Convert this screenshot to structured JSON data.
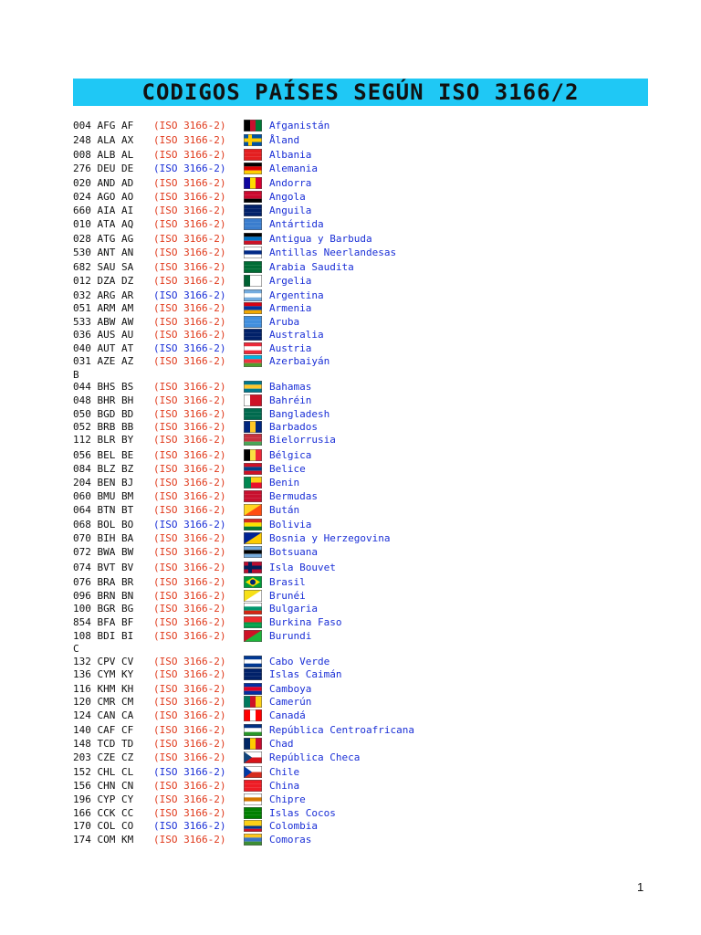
{
  "title": "CODIGOS PAÍSES SEGÚN ISO 3166/2",
  "page_number": "1",
  "colors": {
    "red": "#e03a1c",
    "blue": "#1a2fd6"
  },
  "entries": [
    {
      "codes": "004 AFG AF",
      "iso": "(ISO 3166-2)",
      "iso_color": "red",
      "name": "Afganistán",
      "flag": [
        "#000000",
        "#c8102e",
        "#007a36"
      ],
      "flag_dir": "v"
    },
    {
      "codes": "248 ALA AX",
      "iso": "(ISO 3166-2)",
      "iso_color": "red",
      "name": "Åland",
      "flag": [
        "#0053a5",
        "#ffce00",
        "#0053a5"
      ],
      "flag_dir": "nordic"
    },
    {
      "codes": "008 ALB AL",
      "iso": "(ISO 3166-2)",
      "iso_color": "red",
      "name": "Albania",
      "flag": [
        "#e41e20",
        "#e41e20",
        "#e41e20"
      ],
      "flag_dir": "h"
    },
    {
      "codes": "276 DEU DE",
      "iso": "(ISO 3166-2)",
      "iso_color": "blue",
      "name": "Alemania",
      "flag": [
        "#000000",
        "#dd0000",
        "#ffce00"
      ],
      "flag_dir": "h"
    },
    {
      "codes": "020 AND AD",
      "iso": "(ISO 3166-2)",
      "iso_color": "red",
      "name": "Andorra",
      "flag": [
        "#10069f",
        "#fedd00",
        "#d50032"
      ],
      "flag_dir": "v"
    },
    {
      "codes": "024 AGO AO",
      "iso": "(ISO 3166-2)",
      "iso_color": "red",
      "name": "Angola",
      "flag": [
        "#cc092f",
        "#cc092f",
        "#000000"
      ],
      "flag_dir": "h"
    },
    {
      "codes": "660 AIA AI",
      "iso": "(ISO 3166-2)",
      "iso_color": "red",
      "name": "Anguila",
      "flag": [
        "#012169",
        "#012169",
        "#012169"
      ],
      "flag_dir": "h"
    },
    {
      "codes": "010 ATA AQ",
      "iso": "(ISO 3166-2)",
      "iso_color": "red",
      "name": "Antártida",
      "flag": [
        "#3a7dce",
        "#3a7dce",
        "#3a7dce"
      ],
      "flag_dir": "h"
    },
    {
      "codes": "028 ATG AG",
      "iso": "(ISO 3166-2)",
      "iso_color": "red",
      "name": "Antigua y Barbuda",
      "flag": [
        "#000000",
        "#0072c6",
        "#ce1126"
      ],
      "flag_dir": "h"
    },
    {
      "codes": "530 ANT AN",
      "iso": "(ISO 3166-2)",
      "iso_color": "red",
      "name": "Antillas Neerlandesas",
      "flag": [
        "#ffffff",
        "#012a87",
        "#ffffff"
      ],
      "flag_dir": "h"
    },
    {
      "codes": "682 SAU SA",
      "iso": "(ISO 3166-2)",
      "iso_color": "red",
      "name": "Arabia Saudita",
      "flag": [
        "#006c35",
        "#006c35",
        "#006c35"
      ],
      "flag_dir": "h"
    },
    {
      "codes": "012 DZA DZ",
      "iso": "(ISO 3166-2)",
      "iso_color": "red",
      "name": "Argelia",
      "flag": [
        "#006233",
        "#ffffff",
        "#ffffff"
      ],
      "flag_dir": "v"
    },
    {
      "codes": "032 ARG AR",
      "iso": "(ISO 3166-2)",
      "iso_color": "blue",
      "name": "Argentina",
      "flag": [
        "#74acdf",
        "#ffffff",
        "#74acdf"
      ],
      "flag_dir": "h"
    },
    {
      "codes": "051 ARM AM",
      "iso": "(ISO 3166-2)",
      "iso_color": "red",
      "name": "Armenia",
      "flag": [
        "#d90012",
        "#0033a0",
        "#f2a800"
      ],
      "flag_dir": "h"
    },
    {
      "codes": "533 ABW AW",
      "iso": "(ISO 3166-2)",
      "iso_color": "red",
      "name": "Aruba",
      "flag": [
        "#418fde",
        "#418fde",
        "#418fde"
      ],
      "flag_dir": "h"
    },
    {
      "codes": "036 AUS AU",
      "iso": "(ISO 3166-2)",
      "iso_color": "red",
      "name": "Australia",
      "flag": [
        "#012169",
        "#012169",
        "#012169"
      ],
      "flag_dir": "h"
    },
    {
      "codes": "040 AUT AT",
      "iso": "(ISO 3166-2)",
      "iso_color": "blue",
      "name": "Austria",
      "flag": [
        "#ed2939",
        "#ffffff",
        "#ed2939"
      ],
      "flag_dir": "h"
    },
    {
      "codes": "031 AZE AZ",
      "iso": "(ISO 3166-2)",
      "iso_color": "red",
      "name": "Azerbaiyán",
      "flag": [
        "#00b5e2",
        "#ef3340",
        "#509e2f"
      ],
      "flag_dir": "h"
    },
    {
      "letter": "B"
    },
    {
      "codes": "044 BHS BS",
      "iso": "(ISO 3166-2)",
      "iso_color": "red",
      "name": "Bahamas",
      "flag": [
        "#00778b",
        "#ffc72c",
        "#00778b"
      ],
      "flag_dir": "h"
    },
    {
      "codes": "048 BHR BH",
      "iso": "(ISO 3166-2)",
      "iso_color": "red",
      "name": "Bahréin",
      "flag": [
        "#ffffff",
        "#ce1126",
        "#ce1126"
      ],
      "flag_dir": "v"
    },
    {
      "codes": "050 BGD BD",
      "iso": "(ISO 3166-2)",
      "iso_color": "red",
      "name": "Bangladesh",
      "flag": [
        "#006a4e",
        "#006a4e",
        "#006a4e"
      ],
      "flag_dir": "h"
    },
    {
      "codes": "052 BRB BB",
      "iso": "(ISO 3166-2)",
      "iso_color": "red",
      "name": "Barbados",
      "flag": [
        "#00267f",
        "#ffc726",
        "#00267f"
      ],
      "flag_dir": "v"
    },
    {
      "codes": "112 BLR BY",
      "iso": "(ISO 3166-2)",
      "iso_color": "red",
      "name": "Bielorrusia",
      "flag": [
        "#c8313e",
        "#c8313e",
        "#4aa657"
      ],
      "flag_dir": "h"
    },
    {
      "codes": "056 BEL BE",
      "iso": "(ISO 3166-2)",
      "iso_color": "red",
      "name": " Bélgica",
      "flag": [
        "#000000",
        "#fae042",
        "#ed2939"
      ],
      "flag_dir": "v"
    },
    {
      "codes": "084 BLZ BZ",
      "iso": "(ISO 3166-2)",
      "iso_color": "red",
      "name": "Belice",
      "flag": [
        "#ce1126",
        "#003f87",
        "#ce1126"
      ],
      "flag_dir": "h"
    },
    {
      "codes": "204 BEN BJ",
      "iso": "(ISO 3166-2)",
      "iso_color": "red",
      "name": "Benin",
      "flag": [
        "#008751",
        "#fcd116",
        "#e8112d"
      ],
      "flag_dir": "benin"
    },
    {
      "codes": "060 BMU BM",
      "iso": "(ISO 3166-2)",
      "iso_color": "red",
      "name": "Bermudas",
      "flag": [
        "#c8102e",
        "#c8102e",
        "#c8102e"
      ],
      "flag_dir": "h"
    },
    {
      "codes": "064 BTN BT",
      "iso": "(ISO 3166-2)",
      "iso_color": "red",
      "name": "Bután",
      "flag": [
        "#ffd520",
        "#ff4e12",
        "#ff4e12"
      ],
      "flag_dir": "diag"
    },
    {
      "codes": "068 BOL BO",
      "iso": "(ISO 3166-2)",
      "iso_color": "blue",
      "name": "Bolivia",
      "flag": [
        "#d52b1e",
        "#f9e300",
        "#007934"
      ],
      "flag_dir": "h"
    },
    {
      "codes": "070 BIH BA",
      "iso": "(ISO 3166-2)",
      "iso_color": "red",
      "name": "Bosnia y Herzegovina",
      "flag": [
        "#002395",
        "#fecb00",
        "#002395"
      ],
      "flag_dir": "diag"
    },
    {
      "codes": "072 BWA BW",
      "iso": "(ISO 3166-2)",
      "iso_color": "red",
      "name": "Botsuana",
      "flag": [
        "#75aadb",
        "#000000",
        "#75aadb"
      ],
      "flag_dir": "h"
    },
    {
      "codes": "074 BVT BV",
      "iso": "(ISO 3166-2)",
      "iso_color": "red",
      "name": "Isla Bouvet",
      "flag": [
        "#ba0c2f",
        "#00205b",
        "#ba0c2f"
      ],
      "flag_dir": "nordic"
    },
    {
      "codes": "076 BRA BR",
      "iso": "(ISO 3166-2)",
      "iso_color": "red",
      "name": "Brasil",
      "flag": [
        "#009c3b",
        "#ffdf00",
        "#002776"
      ],
      "flag_dir": "brazil"
    },
    {
      "codes": "096 BRN BN",
      "iso": "(ISO 3166-2)",
      "iso_color": "red",
      "name": "Brunéi",
      "flag": [
        "#f7e017",
        "#ffffff",
        "#000000"
      ],
      "flag_dir": "diag"
    },
    {
      "codes": "100 BGR BG",
      "iso": "(ISO 3166-2)",
      "iso_color": "red",
      "name": "Bulgaria",
      "flag": [
        "#ffffff",
        "#00966e",
        "#d62612"
      ],
      "flag_dir": "h"
    },
    {
      "codes": "854 BFA BF",
      "iso": "(ISO 3166-2)",
      "iso_color": "red",
      "name": "Burkina Faso",
      "flag": [
        "#ef2b2d",
        "#009e49",
        "#009e49"
      ],
      "flag_dir": "h2"
    },
    {
      "codes": "108 BDI BI",
      "iso": "(ISO 3166-2)",
      "iso_color": "red",
      "name": "Burundi",
      "flag": [
        "#ce1126",
        "#1eb53a",
        "#ffffff"
      ],
      "flag_dir": "diag"
    },
    {
      "letter": "C"
    },
    {
      "codes": "132 CPV CV",
      "iso": "(ISO 3166-2)",
      "iso_color": "red",
      "name": "Cabo Verde",
      "flag": [
        "#003893",
        "#ffffff",
        "#003893"
      ],
      "flag_dir": "h"
    },
    {
      "codes": "136 CYM KY",
      "iso": "(ISO 3166-2)",
      "iso_color": "red",
      "name": "Islas Caimán",
      "flag": [
        "#012169",
        "#012169",
        "#012169"
      ],
      "flag_dir": "h"
    },
    {
      "codes": "116 KHM KH",
      "iso": "(ISO 3166-2)",
      "iso_color": "red",
      "name": "Camboya",
      "flag": [
        "#032ea1",
        "#e00025",
        "#032ea1"
      ],
      "flag_dir": "h"
    },
    {
      "codes": "120 CMR CM",
      "iso": "(ISO 3166-2)",
      "iso_color": "red",
      "name": "Camerún",
      "flag": [
        "#007a5e",
        "#ce1126",
        "#fcd116"
      ],
      "flag_dir": "v"
    },
    {
      "codes": "124 CAN CA",
      "iso": "(ISO 3166-2)",
      "iso_color": "red",
      "name": "Canadá",
      "flag": [
        "#ff0000",
        "#ffffff",
        "#ff0000"
      ],
      "flag_dir": "v"
    },
    {
      "codes": "140 CAF CF",
      "iso": "(ISO 3166-2)",
      "iso_color": "red",
      "name": "República Centroafricana",
      "flag": [
        "#003082",
        "#ffffff",
        "#289728"
      ],
      "flag_dir": "h"
    },
    {
      "codes": "148 TCD TD",
      "iso": "(ISO 3166-2)",
      "iso_color": "red",
      "name": "Chad",
      "flag": [
        "#002664",
        "#fecb00",
        "#c60c30"
      ],
      "flag_dir": "v"
    },
    {
      "codes": "203 CZE CZ",
      "iso": "(ISO 3166-2)",
      "iso_color": "red",
      "name": "República Checa",
      "flag": [
        "#ffffff",
        "#d7141a",
        "#11457e"
      ],
      "flag_dir": "czech"
    },
    {
      "codes": "152 CHL CL",
      "iso": "(ISO 3166-2)",
      "iso_color": "blue",
      "name": "Chile",
      "flag": [
        "#ffffff",
        "#d52b1e",
        "#0039a6"
      ],
      "flag_dir": "czech"
    },
    {
      "codes": "156 CHN CN",
      "iso": "(ISO 3166-2)",
      "iso_color": "red",
      "name": "China",
      "flag": [
        "#ee1c25",
        "#ee1c25",
        "#ee1c25"
      ],
      "flag_dir": "h"
    },
    {
      "codes": "196 CYP CY",
      "iso": "(ISO 3166-2)",
      "iso_color": "red",
      "name": "Chipre",
      "flag": [
        "#ffffff",
        "#d57800",
        "#ffffff"
      ],
      "flag_dir": "h"
    },
    {
      "codes": "166 CCK CC",
      "iso": "(ISO 3166-2)",
      "iso_color": "red",
      "name": "Islas Cocos",
      "flag": [
        "#008000",
        "#008000",
        "#008000"
      ],
      "flag_dir": "h"
    },
    {
      "codes": "170 COL CO",
      "iso": "(ISO 3166-2)",
      "iso_color": "blue",
      "name": "Colombia",
      "flag": [
        "#fcd116",
        "#003893",
        "#ce1126"
      ],
      "flag_dir": "h2"
    },
    {
      "codes": "174 COM KM",
      "iso": "(ISO 3166-2)",
      "iso_color": "red",
      "name": "Comoras",
      "flag": [
        "#ffc61e",
        "#3a75c4",
        "#3d8e33"
      ],
      "flag_dir": "h"
    }
  ]
}
